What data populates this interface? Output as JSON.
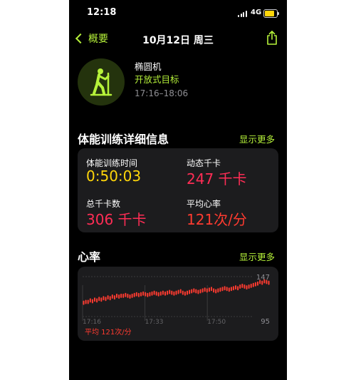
{
  "status_bar": {
    "time": "12:18",
    "network": "4G",
    "battery_level": 0.8
  },
  "nav": {
    "back_label": "概要",
    "title": "10月12日 周三"
  },
  "workout": {
    "name": "椭圆机",
    "goal": "开放式目标",
    "time_range": "17:16–18:06",
    "icon": "elliptical-icon"
  },
  "details": {
    "heading": "体能训练详细信息",
    "show_more": "显示更多",
    "stats": [
      {
        "label": "体能训练时间",
        "value": "0:50:03",
        "color": "#ffd60a"
      },
      {
        "label": "动态千卡",
        "value": "247 千卡",
        "color": "#ff2d55"
      },
      {
        "label": "总千卡数",
        "value": "306 千卡",
        "color": "#ff2d55"
      },
      {
        "label": "平均心率",
        "value": "121次/分",
        "color": "#ff3b30"
      }
    ]
  },
  "heart_rate": {
    "heading": "心率",
    "show_more": "显示更多",
    "max_label": "147",
    "min_label": "95",
    "average": "平均 121次/分",
    "x_ticks": [
      "17:16",
      "17:33",
      "17:50"
    ],
    "color": "#ff3b30"
  },
  "chart_data": {
    "type": "bar",
    "title": "",
    "xlabel": "",
    "ylabel": "",
    "ylim": [
      95,
      147
    ],
    "x_ticks": [
      "17:16",
      "17:33",
      "17:50"
    ],
    "series": [
      {
        "values": [
          113,
          114,
          114,
          116,
          115,
          117,
          116,
          118,
          117,
          119,
          118,
          120,
          119,
          121,
          120,
          122,
          121,
          122,
          122,
          123,
          122,
          121,
          122,
          123,
          124,
          123,
          124,
          125,
          124,
          123,
          124,
          125,
          126,
          125,
          124,
          125,
          126,
          125,
          126,
          127,
          126,
          125,
          126,
          127,
          128,
          126,
          125,
          126,
          127,
          128,
          129,
          128,
          127,
          128,
          129,
          130,
          129,
          130,
          131,
          129,
          128,
          129,
          130,
          131,
          132,
          131,
          130,
          131,
          132,
          133,
          132,
          134,
          135,
          134,
          133,
          134,
          135,
          136,
          137,
          138,
          140,
          139,
          141,
          140,
          139
        ]
      }
    ]
  }
}
